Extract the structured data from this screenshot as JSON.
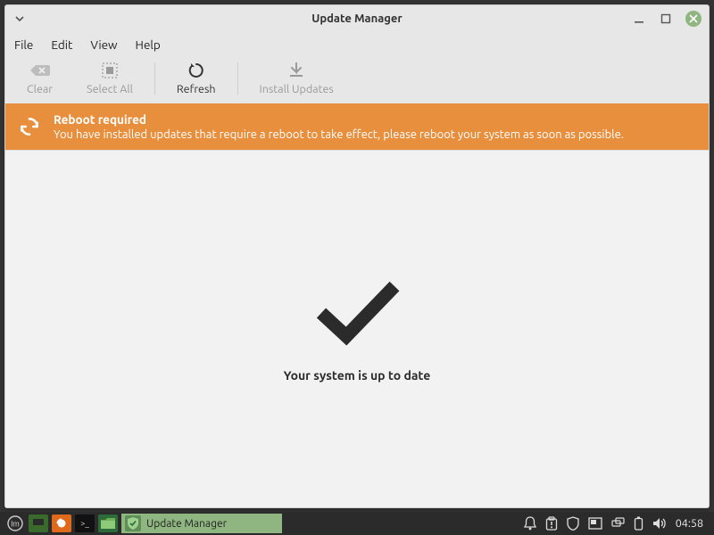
{
  "window": {
    "title": "Update Manager"
  },
  "menubar": {
    "file": "File",
    "edit": "Edit",
    "view": "View",
    "help": "Help"
  },
  "toolbar": {
    "clear": "Clear",
    "select_all": "Select All",
    "refresh": "Refresh",
    "install": "Install Updates"
  },
  "banner": {
    "title": "Reboot required",
    "body": "You have installed updates that require a reboot to take effect, please reboot your system as soon as possible."
  },
  "content": {
    "status": "Your system is up to date"
  },
  "taskbar": {
    "app_label": "Update Manager",
    "terminal_glyph": ">_",
    "clock": "04:58"
  },
  "colors": {
    "banner_bg": "#e88f3e",
    "accent_green": "#8fb581"
  }
}
